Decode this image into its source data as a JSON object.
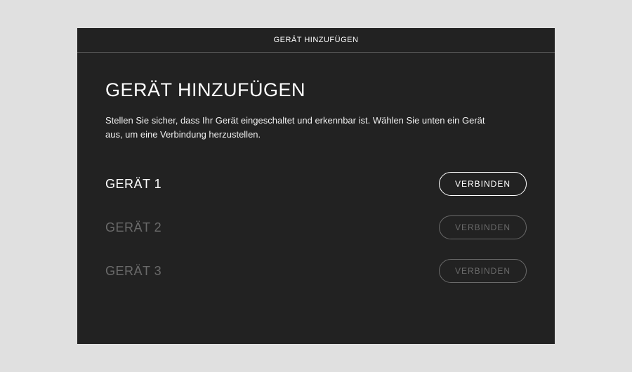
{
  "header": {
    "title": "GERÄT HINZUFÜGEN"
  },
  "main": {
    "title": "GERÄT HINZUFÜGEN",
    "description": "Stellen Sie sicher, dass Ihr Gerät eingeschaltet und erkennbar ist. Wählen Sie unten ein Gerät aus, um eine Verbindung herzustellen."
  },
  "devices": [
    {
      "name": "GERÄT 1",
      "button": "VERBINDEN",
      "available": true
    },
    {
      "name": "GERÄT 2",
      "button": "VERBINDEN",
      "available": false
    },
    {
      "name": "GERÄT 3",
      "button": "VERBINDEN",
      "available": false
    }
  ]
}
